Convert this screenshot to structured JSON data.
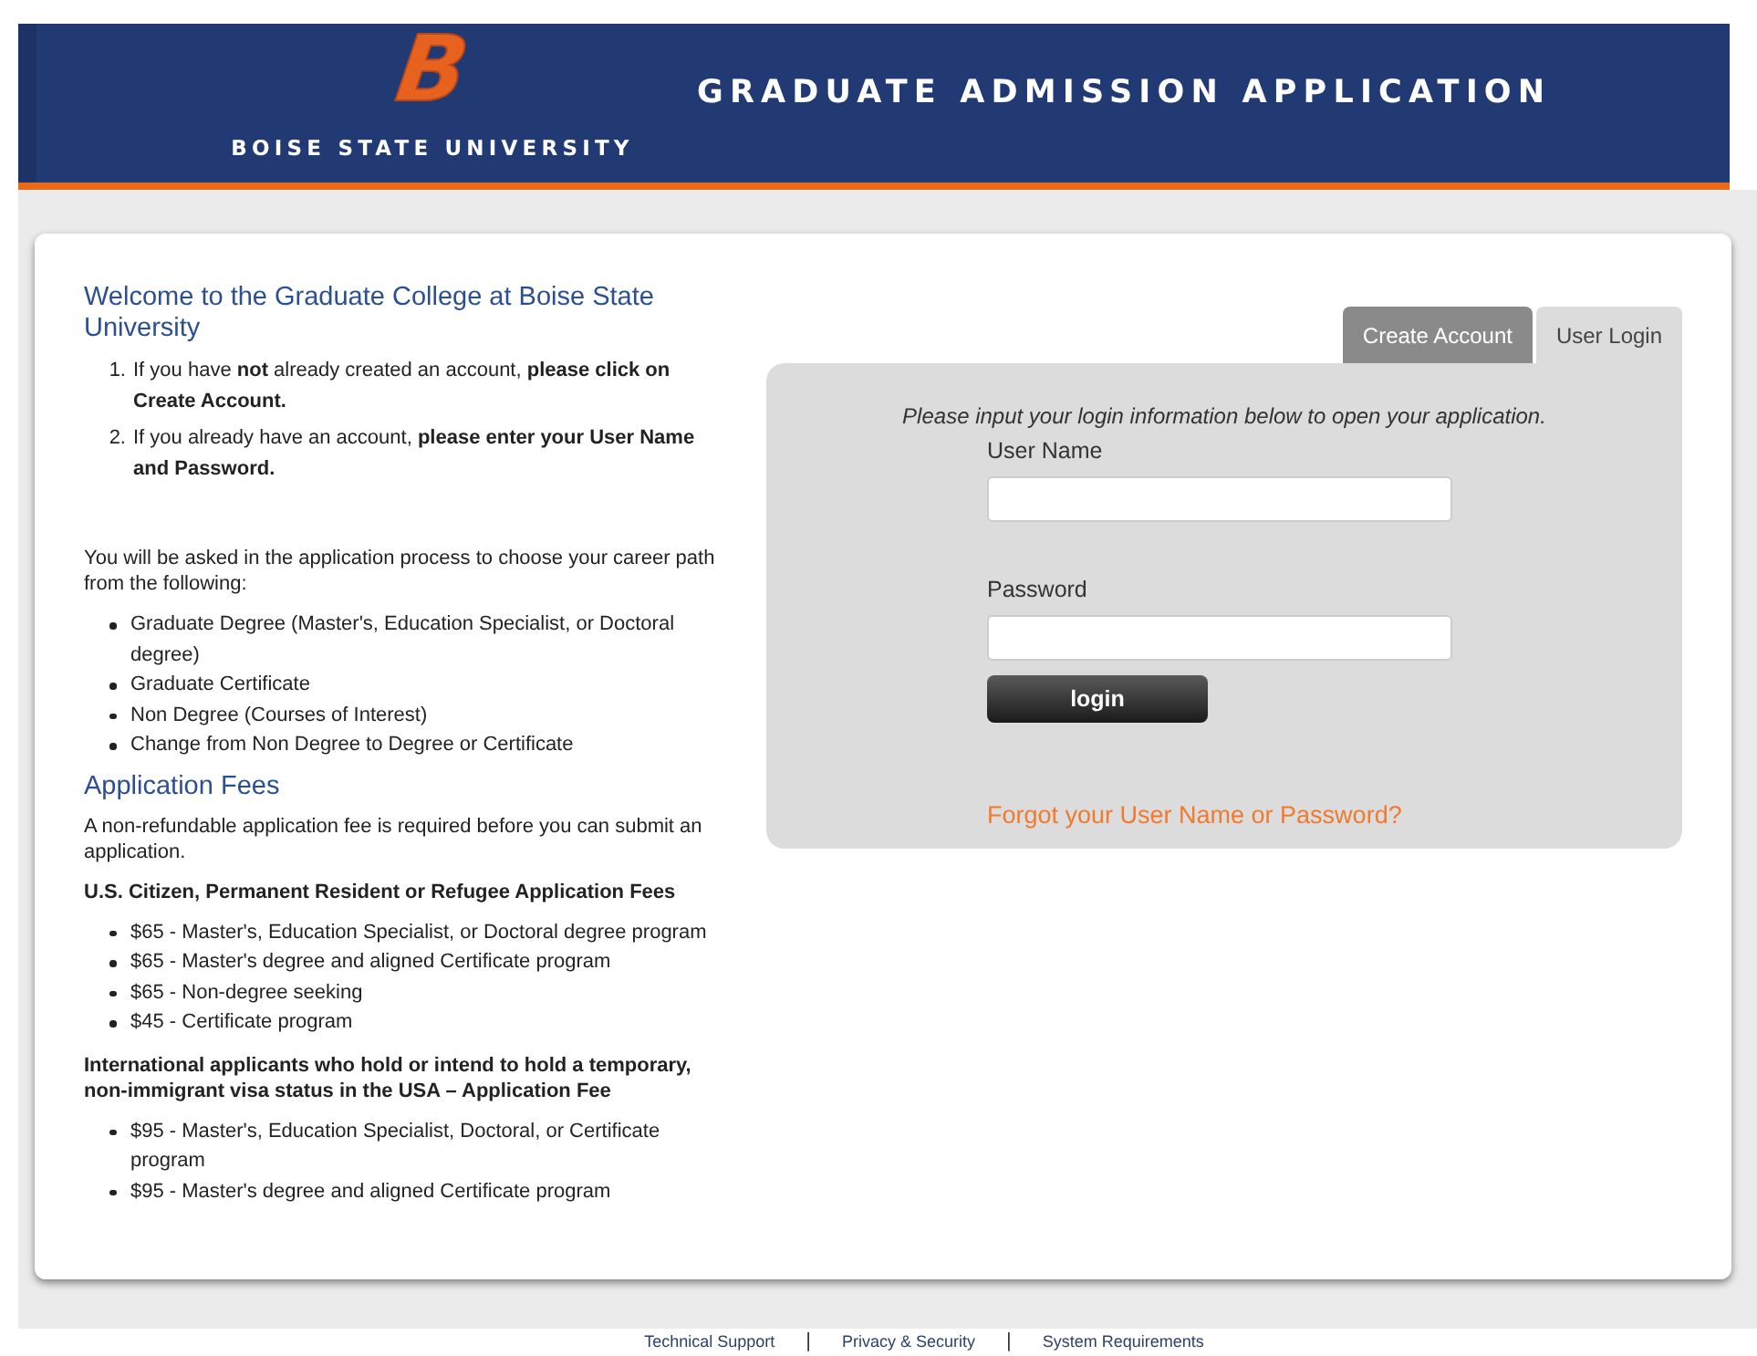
{
  "header": {
    "logo_letter": "B",
    "university": "BOISE STATE UNIVERSITY",
    "title": "GRADUATE ADMISSION APPLICATION"
  },
  "welcome": {
    "heading": "Welcome to the Graduate College at Boise State University",
    "steps": [
      {
        "number": "1.",
        "text": "If you have **not** already created an account, **please click on Create Account.**"
      },
      {
        "number": "2.",
        "text": "If you already have an account, **please enter your User Name and Password.**"
      }
    ],
    "career_intro": "You will be asked in the application process to choose your career path from the following:",
    "career_paths": [
      "Graduate Degree (Master's, Education Specialist, or Doctoral degree)",
      "Graduate Certificate",
      "Non Degree (Courses of Interest)",
      "Change from Non Degree to Degree or Certificate"
    ]
  },
  "fees": {
    "heading": "Application Fees",
    "intro": "A non-refundable application fee is required before you can submit an application.",
    "groups": [
      {
        "title": "U.S. Citizen, Permanent Resident or Refugee Application Fees",
        "items": [
          "$65 - Master's, Education Specialist, or Doctoral degree program",
          "$65 - Master's degree and aligned Certificate program",
          "$65 - Non-degree seeking",
          "$45 - Certificate program"
        ]
      },
      {
        "title": "International applicants who hold or intend to hold a temporary, non-immigrant visa status in the USA – Application Fee",
        "items": [
          "$95 - Master's, Education Specialist, Doctoral, or Certificate program",
          "$95 - Master's degree and aligned Certificate program"
        ]
      }
    ]
  },
  "tabs": [
    {
      "label": "Create Account",
      "selected": false
    },
    {
      "label": "User Login",
      "selected": true
    }
  ],
  "login": {
    "instruction": "Please input your login information below to open your application.",
    "fields": [
      {
        "label": "User Name"
      },
      {
        "label": "Password"
      }
    ],
    "button": "login",
    "forgot_link": "Forgot your User Name or Password?"
  },
  "footer": {
    "links": [
      "Technical Support",
      "Privacy & Security",
      "System Requirements"
    ],
    "separator": "|"
  }
}
